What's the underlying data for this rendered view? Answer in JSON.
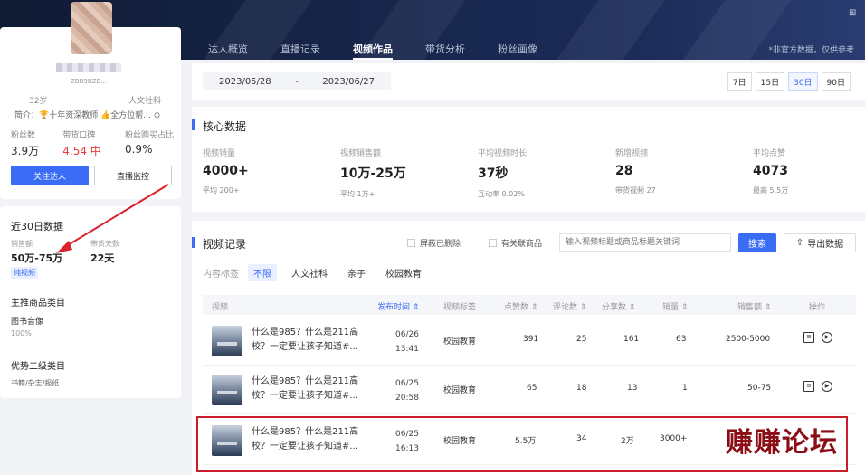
{
  "nav": {
    "tabs": [
      {
        "label": "达人概览"
      },
      {
        "label": "直播记录"
      },
      {
        "label": "视频作品"
      },
      {
        "label": "带货分析"
      },
      {
        "label": "粉丝画像"
      }
    ],
    "active_tab": 2,
    "note": "*非官方数据，仅供参考"
  },
  "profile": {
    "id_text": "ZBB9BZB...",
    "age": "32岁",
    "category": "人文社科",
    "intro": "简介：🏆十年资深教师 👍全方位帮... ⊙",
    "stats": [
      {
        "label": "粉丝数",
        "value": "3.9万",
        "color": "normal"
      },
      {
        "label": "带货口碑",
        "value": "4.54 中",
        "color": "red"
      },
      {
        "label": "粉丝购买占比",
        "value": "0.9%",
        "color": "normal"
      }
    ],
    "follow_label": "关注达人",
    "live_monitor_label": "直播监控"
  },
  "last30": {
    "title": "近30日数据",
    "sales_label": "销售额",
    "days_label": "带货天数",
    "sales_value": "50万-75万",
    "days_value": "22天",
    "tag": "纯视频",
    "main_category_title": "主推商品类目",
    "main_category": "图书音像",
    "main_category_pct": "100%",
    "secondary_title": "优势二级类目",
    "secondary": "书籍/杂志/报纸"
  },
  "datebar": {
    "start": "2023/05/28",
    "sep": "-",
    "end": "2023/06/27",
    "ranges": [
      "7日",
      "15日",
      "30日",
      "90日"
    ],
    "active_range": 2
  },
  "core": {
    "title": "核心数据",
    "metrics": [
      {
        "label": "视频销量",
        "value": "4000+",
        "sub": "平均 200+"
      },
      {
        "label": "视频销售额",
        "value": "10万-25万",
        "sub": "平均 1万+"
      },
      {
        "label": "平均视频时长",
        "value": "37秒",
        "sub": "互动率 0.02%"
      },
      {
        "label": "新增视频",
        "value": "28",
        "sub": "带货视频 27"
      },
      {
        "label": "平均点赞",
        "value": "4073",
        "sub": "最高 5.5万"
      }
    ]
  },
  "records": {
    "title": "视频记录",
    "check_hide_deleted": "屏蔽已删除",
    "check_has_product": "有关联商品",
    "search_placeholder": "输入视频标题或商品标题关键词",
    "search_label": "搜索",
    "export_label": "导出数据",
    "tag_label": "内容标签",
    "tags": [
      "不限",
      "人文社科",
      "亲子",
      "校园教育"
    ],
    "active_tag": 0,
    "columns": [
      "视频",
      "发布时间 ⇕",
      "视频标签",
      "点赞数 ⇕",
      "评论数 ⇕",
      "分享数 ⇕",
      "销量 ⇕",
      "销售额 ⇕",
      "操作"
    ],
    "rows": [
      {
        "title": "什么是985？什么是211高校？一定要让孩子知道#...",
        "date": "06/26",
        "time": "13:41",
        "tag": "校园教育",
        "likes": "391",
        "comments": "25",
        "shares": "161",
        "sales": "63",
        "revenue": "2500-5000"
      },
      {
        "title": "什么是985？什么是211高校？一定要让孩子知道#...",
        "date": "06/25",
        "time": "20:58",
        "tag": "校园教育",
        "likes": "65",
        "comments": "18",
        "shares": "13",
        "sales": "1",
        "revenue": "50-75"
      },
      {
        "title": "什么是985？什么是211高校？一定要让孩子知道#...",
        "date": "06/25",
        "time": "16:13",
        "tag": "校园教育",
        "likes": "5.5万",
        "comments": "34",
        "shares": "2万",
        "sales": "3000+",
        "revenue": ""
      }
    ]
  },
  "watermark": "赚赚论坛"
}
